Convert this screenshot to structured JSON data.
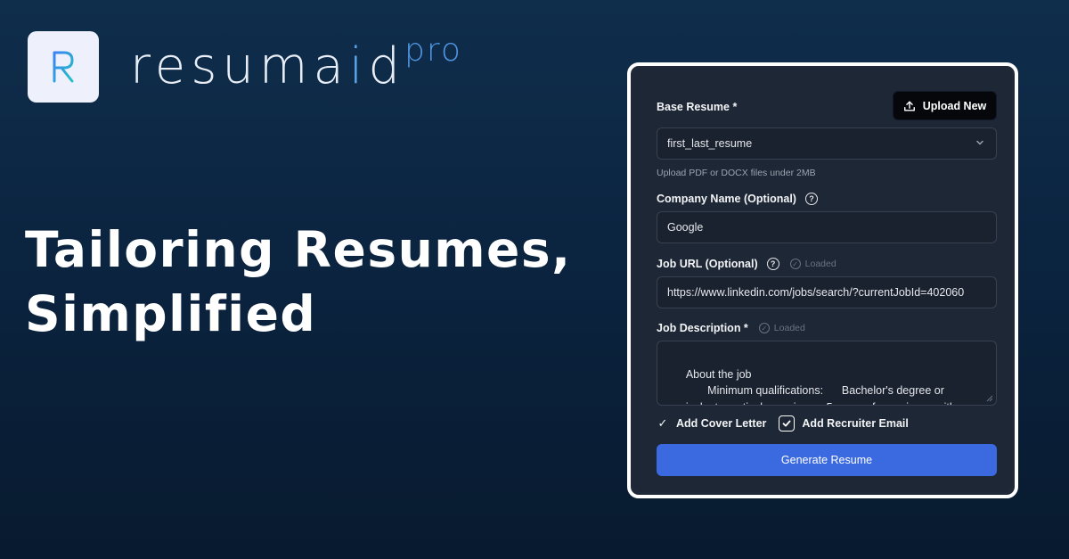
{
  "brand": {
    "logo_letter": "R",
    "name_part1": "resuma",
    "name_accent": "i",
    "name_part2": "d",
    "suffix": "pro"
  },
  "headline": {
    "line1": "Tailoring Resumes,",
    "line2": "Simplified"
  },
  "form": {
    "base_resume": {
      "label": "Base Resume *",
      "value": "first_last_resume",
      "hint": "Upload PDF or DOCX files under 2MB"
    },
    "upload_button": "Upload New",
    "company": {
      "label": "Company Name (Optional)",
      "value": "Google"
    },
    "job_url": {
      "label": "Job URL (Optional)",
      "status": "Loaded",
      "value": "https://www.linkedin.com/jobs/search/?currentJobId=402060"
    },
    "job_description": {
      "label": "Job Description *",
      "status": "Loaded",
      "value": "About the job\n             Minimum qualifications:      Bachelor's degree or equivalent practical experience. 5 years of experience with software development in one or more programming"
    },
    "checkboxes": [
      {
        "label": "Add Cover Letter",
        "checked": true
      },
      {
        "label": "Add Recruiter Email",
        "checked": true
      }
    ],
    "generate_button": "Generate Resume"
  },
  "colors": {
    "background": "#0b2440",
    "card": "#1e2735",
    "primary_button": "#3b6ae0",
    "brand_accent": "#4f95e0"
  }
}
